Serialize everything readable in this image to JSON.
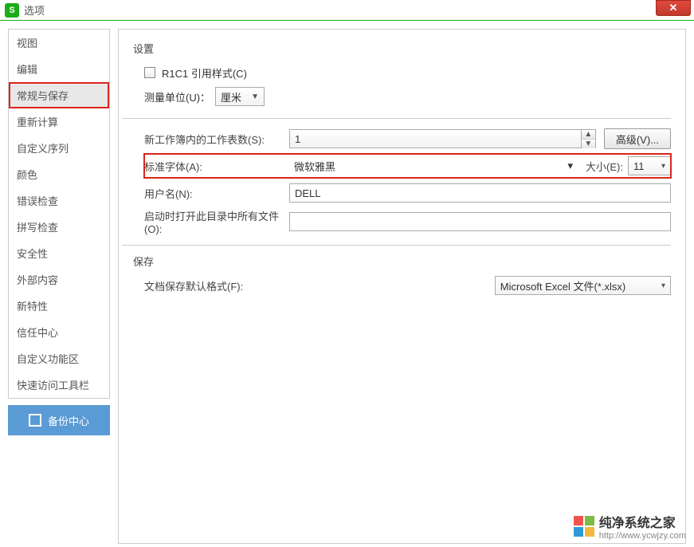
{
  "window": {
    "title": "选项"
  },
  "icons": {
    "close_x": "✕"
  },
  "sidebar": {
    "items": [
      {
        "label": "视图"
      },
      {
        "label": "编辑"
      },
      {
        "label": "常规与保存"
      },
      {
        "label": "重新计算"
      },
      {
        "label": "自定义序列"
      },
      {
        "label": "颜色"
      },
      {
        "label": "错误检查"
      },
      {
        "label": "拼写检查"
      },
      {
        "label": "安全性"
      },
      {
        "label": "外部内容"
      },
      {
        "label": "新特性"
      },
      {
        "label": "信任中心"
      },
      {
        "label": "自定义功能区"
      },
      {
        "label": "快速访问工具栏"
      }
    ],
    "backup_label": "备份中心"
  },
  "settings": {
    "section_label": "设置",
    "r1c1_label": "R1C1 引用样式(C)",
    "measure_label": "测量单位(U)：",
    "measure_value": "厘米",
    "sheets_label": "新工作簿内的工作表数(S):",
    "sheets_value": "1",
    "advanced_label": "高级(V)...",
    "font_label": "标准字体(A):",
    "font_value": "微软雅黑",
    "size_label": "大小(E):",
    "size_value": "11",
    "user_label": "用户名(N):",
    "user_value": "DELL",
    "openall_label": "启动时打开此目录中所有文件(O):",
    "openall_value": ""
  },
  "save": {
    "section_label": "保存",
    "default_fmt_label": "文档保存默认格式(F):",
    "default_fmt_value": "Microsoft Excel 文件(*.xlsx)"
  },
  "watermark": {
    "text1": "纯净系统之家",
    "text2": "http://www.ycwjzy.com"
  }
}
